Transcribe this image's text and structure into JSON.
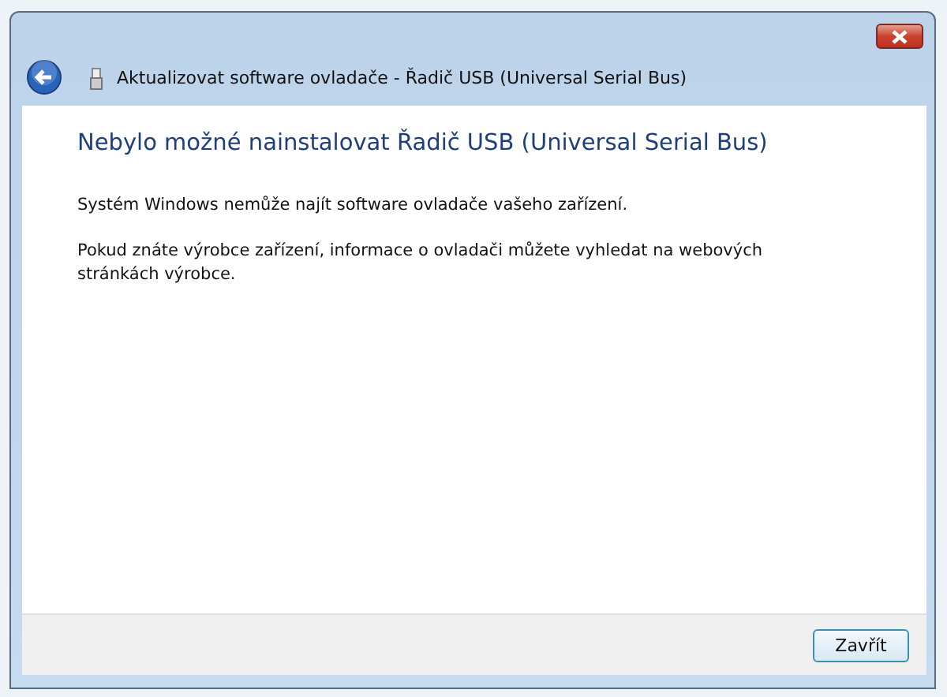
{
  "window": {
    "title": "Aktualizovat software ovladače - Řadič USB (Universal Serial Bus)"
  },
  "heading": "Nebylo možné nainstalovat Řadič USB (Universal Serial Bus)",
  "paragraphs": [
    "Systém Windows nemůže najít software ovladače vašeho zařízení.",
    "Pokud znáte výrobce zařízení, informace o ovladači můžete vyhledat na webových stránkách výrobce."
  ],
  "buttons": [
    "Zavřít"
  ]
}
